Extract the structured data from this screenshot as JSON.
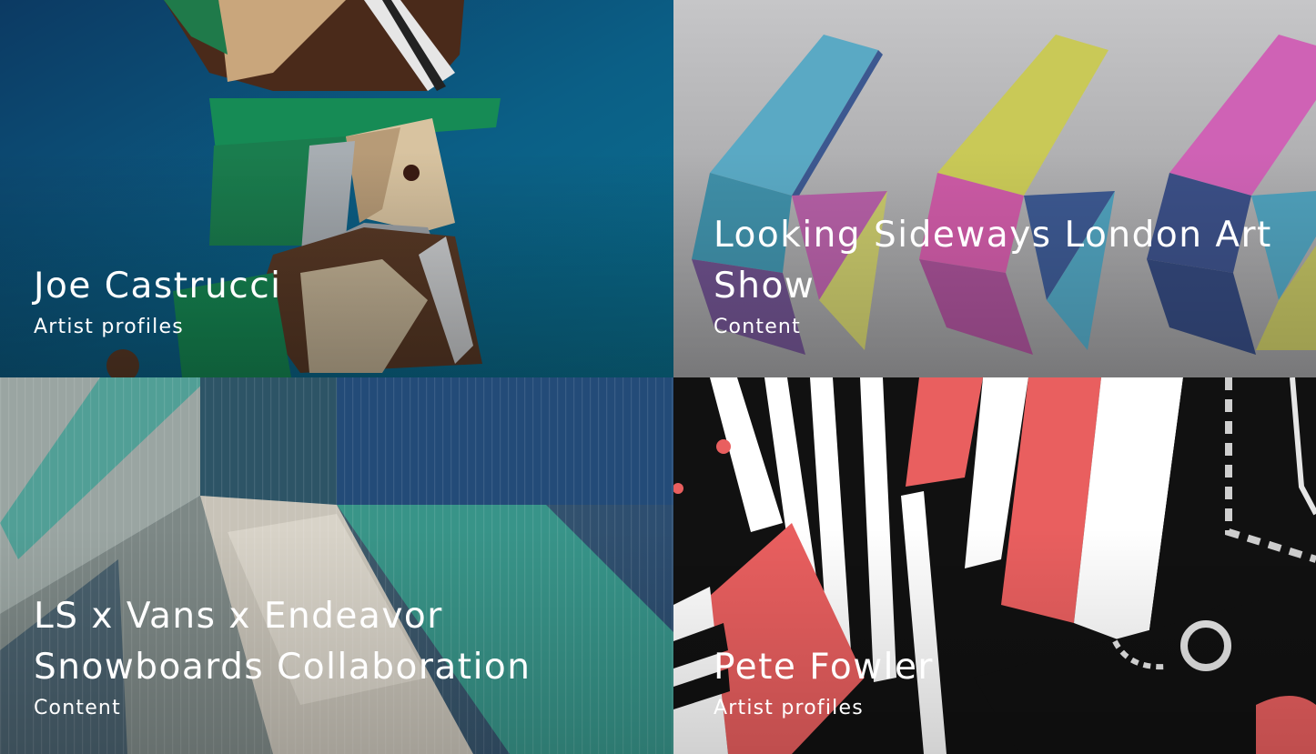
{
  "tiles": [
    {
      "title": "Joe Castrucci",
      "category": "Artist profiles"
    },
    {
      "title": "Looking Sideways London Art Show",
      "category": "Content"
    },
    {
      "title": "LS x Vans x Endeavor Snowboards Collaboration",
      "category": "Content"
    },
    {
      "title": "Pete Fowler",
      "category": "Artist profiles"
    }
  ]
}
